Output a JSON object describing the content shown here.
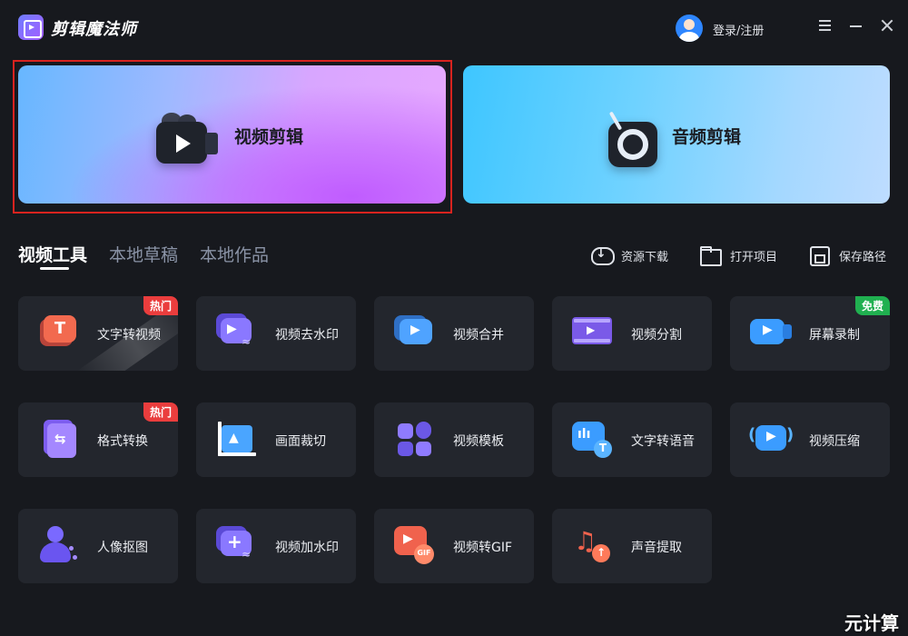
{
  "app": {
    "title": "剪辑魔法师"
  },
  "header": {
    "login_label": "登录/注册"
  },
  "hero": {
    "video_label": "视频剪辑",
    "audio_label": "音频剪辑"
  },
  "tabs": [
    {
      "label": "视频工具",
      "active": true
    },
    {
      "label": "本地草稿",
      "active": false
    },
    {
      "label": "本地作品",
      "active": false
    }
  ],
  "actions": {
    "download_label": "资源下载",
    "open_label": "打开项目",
    "save_label": "保存路径"
  },
  "tools": [
    {
      "label": "文字转视频",
      "badge": "热门",
      "icon": "text-to-video-icon"
    },
    {
      "label": "视频去水印",
      "badge": "",
      "icon": "remove-watermark-icon"
    },
    {
      "label": "视频合并",
      "badge": "",
      "icon": "merge-video-icon"
    },
    {
      "label": "视频分割",
      "badge": "",
      "icon": "split-video-icon"
    },
    {
      "label": "屏幕录制",
      "badge": "免费",
      "icon": "screen-record-icon"
    },
    {
      "label": "格式转换",
      "badge": "热门",
      "icon": "format-convert-icon"
    },
    {
      "label": "画面裁切",
      "badge": "",
      "icon": "crop-icon"
    },
    {
      "label": "视频模板",
      "badge": "",
      "icon": "template-icon"
    },
    {
      "label": "文字转语音",
      "badge": "",
      "icon": "text-to-speech-icon"
    },
    {
      "label": "视频压缩",
      "badge": "",
      "icon": "compress-icon"
    },
    {
      "label": "人像抠图",
      "badge": "",
      "icon": "portrait-cutout-icon"
    },
    {
      "label": "视频加水印",
      "badge": "",
      "icon": "add-watermark-icon"
    },
    {
      "label": "视频转GIF",
      "badge": "",
      "icon": "video-to-gif-icon"
    },
    {
      "label": "声音提取",
      "badge": "",
      "icon": "audio-extract-icon"
    }
  ],
  "colors": {
    "background": "#17191e",
    "card": "#23262d",
    "hot_badge": "#ea3d3d",
    "free_badge": "#20b050",
    "highlight_outline": "#d8231f"
  },
  "watermark": "元计算"
}
